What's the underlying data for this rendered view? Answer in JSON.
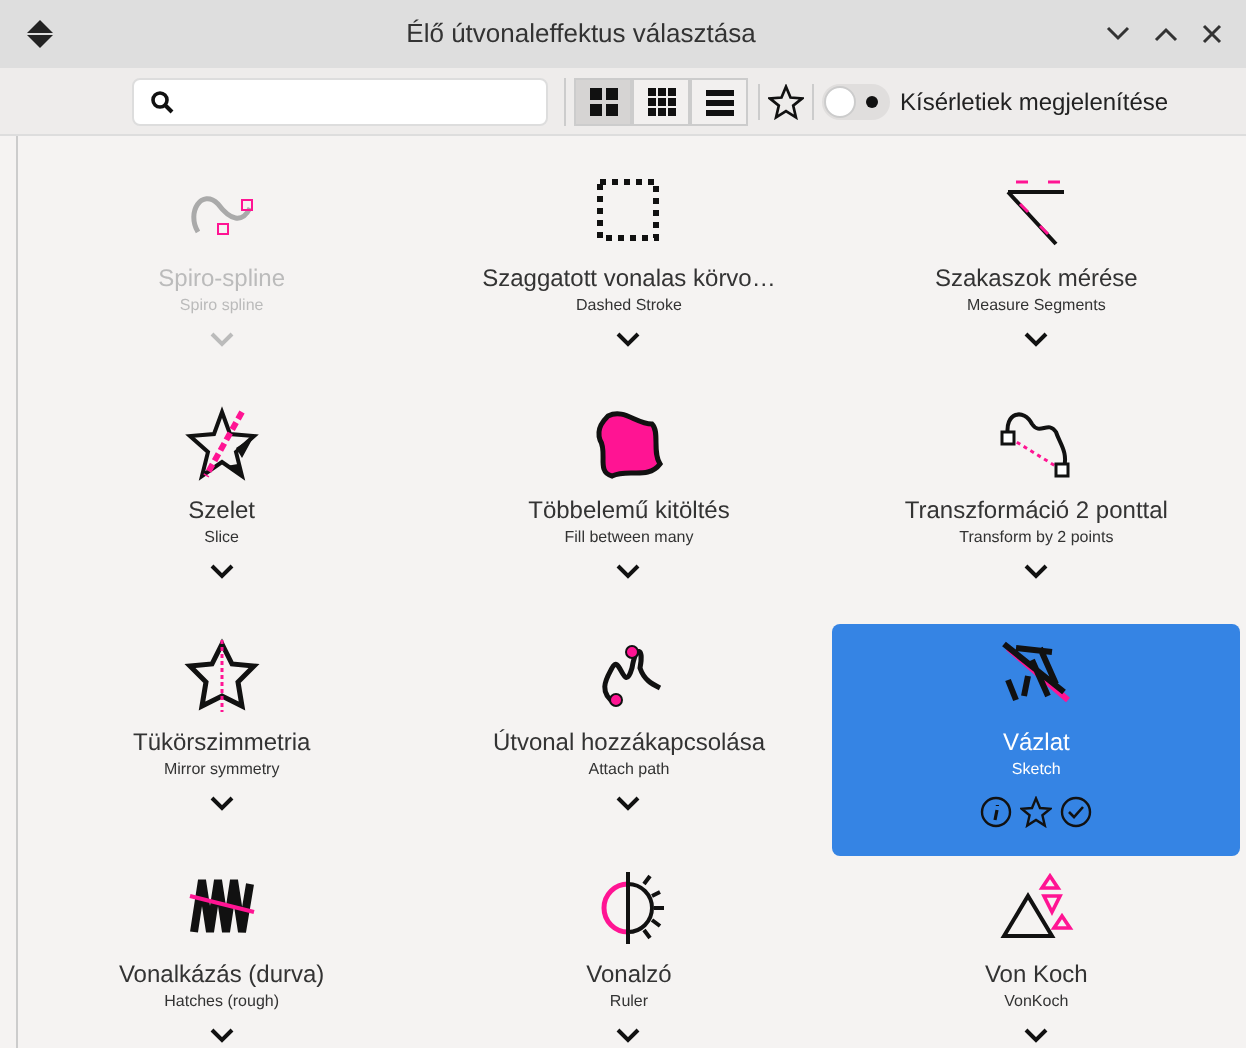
{
  "window": {
    "title": "Élő útvonaleffektus választása"
  },
  "toolbar": {
    "views": [
      {
        "selected": true
      },
      {
        "selected": false
      },
      {
        "selected": false
      }
    ],
    "favorites_only": false,
    "experimental_toggle": {
      "on": false,
      "label": "Kísérletiek megjelenítése"
    }
  },
  "effects": [
    {
      "title": "Spiro-spline",
      "subtitle": "Spiro spline",
      "disabled": true,
      "selected": false
    },
    {
      "title": "Szaggatott vonalas körvo…",
      "subtitle": "Dashed Stroke",
      "disabled": false,
      "selected": false
    },
    {
      "title": "Szakaszok mérése",
      "subtitle": "Measure Segments",
      "disabled": false,
      "selected": false
    },
    {
      "title": "Szelet",
      "subtitle": "Slice",
      "disabled": false,
      "selected": false
    },
    {
      "title": "Többelemű kitöltés",
      "subtitle": "Fill between many",
      "disabled": false,
      "selected": false
    },
    {
      "title": "Transzformáció 2 ponttal",
      "subtitle": "Transform by 2 points",
      "disabled": false,
      "selected": false
    },
    {
      "title": "Tükörszimmetria",
      "subtitle": "Mirror symmetry",
      "disabled": false,
      "selected": false
    },
    {
      "title": "Útvonal hozzákapcsolása",
      "subtitle": "Attach path",
      "disabled": false,
      "selected": false
    },
    {
      "title": "Vázlat",
      "subtitle": "Sketch",
      "disabled": false,
      "selected": true
    },
    {
      "title": "Vonalkázás (durva)",
      "subtitle": "Hatches (rough)",
      "disabled": false,
      "selected": false
    },
    {
      "title": "Vonalzó",
      "subtitle": "Ruler",
      "disabled": false,
      "selected": false
    },
    {
      "title": "Von Koch",
      "subtitle": "VonKoch",
      "disabled": false,
      "selected": false
    }
  ]
}
